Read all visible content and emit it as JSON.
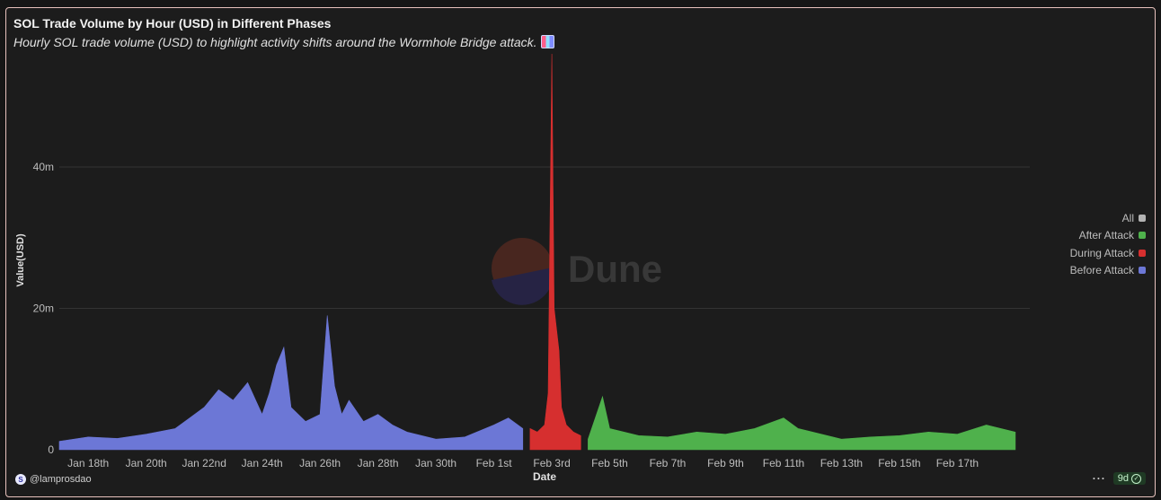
{
  "header": {
    "title": "SOL Trade Volume by Hour (USD) in Different Phases",
    "subtitle": "Hourly SOL trade volume (USD) to highlight activity shifts around the Wormhole Bridge attack.",
    "subtitle_icon": "bar-chart-emoji-icon"
  },
  "watermark": {
    "text": "Dune"
  },
  "footer": {
    "author": "@lamprosdao",
    "more_label": "···",
    "age": "9d"
  },
  "chart_data": {
    "type": "area",
    "xlabel": "Date",
    "ylabel": "Value(USD)",
    "ylim": [
      0,
      56000000
    ],
    "y_ticks": [
      {
        "value": 0,
        "label": "0"
      },
      {
        "value": 20000000,
        "label": "20m"
      },
      {
        "value": 40000000,
        "label": "40m"
      }
    ],
    "x_ticks": [
      "Jan 18th",
      "Jan 20th",
      "Jan 22nd",
      "Jan 24th",
      "Jan 26th",
      "Jan 28th",
      "Jan 30th",
      "Feb 1st",
      "Feb 3rd",
      "Feb 5th",
      "Feb 7th",
      "Feb 9th",
      "Feb 11th",
      "Feb 13th",
      "Feb 15th",
      "Feb 17th"
    ],
    "legend_position": "right",
    "legend": [
      {
        "name": "All",
        "color": "#b3b3b3"
      },
      {
        "name": "After Attack",
        "color": "#4fb14c"
      },
      {
        "name": "During Attack",
        "color": "#d62f2f"
      },
      {
        "name": "Before Attack",
        "color": "#6c77d6"
      }
    ],
    "series": [
      {
        "name": "Before Attack",
        "color": "#6c77d6",
        "x": [
          "2022-01-17",
          "2022-01-18",
          "2022-01-19",
          "2022-01-20",
          "2022-01-21",
          "2022-01-21T12",
          "2022-01-22",
          "2022-01-22T12",
          "2022-01-23",
          "2022-01-23T12",
          "2022-01-24",
          "2022-01-24T06",
          "2022-01-24T12",
          "2022-01-24T18",
          "2022-01-25",
          "2022-01-25T12",
          "2022-01-26",
          "2022-01-26T06",
          "2022-01-26T12",
          "2022-01-26T18",
          "2022-01-27",
          "2022-01-27T12",
          "2022-01-28",
          "2022-01-28T12",
          "2022-01-29",
          "2022-01-30",
          "2022-01-31",
          "2022-02-01",
          "2022-02-01T12",
          "2022-02-02"
        ],
        "values": [
          1200000,
          1800000,
          1600000,
          2200000,
          3000000,
          4500000,
          6000000,
          8500000,
          7000000,
          9500000,
          5000000,
          8000000,
          12000000,
          14500000,
          6000000,
          4000000,
          5000000,
          19000000,
          9000000,
          5000000,
          7000000,
          4000000,
          5000000,
          3500000,
          2500000,
          1500000,
          1800000,
          3500000,
          4500000,
          3000000
        ]
      },
      {
        "name": "During Attack",
        "color": "#d62f2f",
        "x": [
          "2022-02-02T06",
          "2022-02-02T12",
          "2022-02-02T18",
          "2022-02-02T21",
          "2022-02-03",
          "2022-02-03T02",
          "2022-02-03T06",
          "2022-02-03T08",
          "2022-02-03T12",
          "2022-02-03T18",
          "2022-02-04"
        ],
        "values": [
          3000000,
          2500000,
          3500000,
          8000000,
          56000000,
          20000000,
          14000000,
          6000000,
          3500000,
          2500000,
          2000000
        ]
      },
      {
        "name": "After Attack",
        "color": "#4fb14c",
        "x": [
          "2022-02-04T06",
          "2022-02-04T18",
          "2022-02-05",
          "2022-02-06",
          "2022-02-07",
          "2022-02-08",
          "2022-02-09",
          "2022-02-10",
          "2022-02-11",
          "2022-02-11T12",
          "2022-02-12",
          "2022-02-13",
          "2022-02-14",
          "2022-02-15",
          "2022-02-16",
          "2022-02-17",
          "2022-02-18",
          "2022-02-19"
        ],
        "values": [
          1500000,
          7500000,
          3000000,
          2000000,
          1800000,
          2500000,
          2200000,
          3000000,
          4500000,
          3000000,
          2500000,
          1500000,
          1800000,
          2000000,
          2500000,
          2200000,
          3500000,
          2500000
        ]
      }
    ]
  }
}
